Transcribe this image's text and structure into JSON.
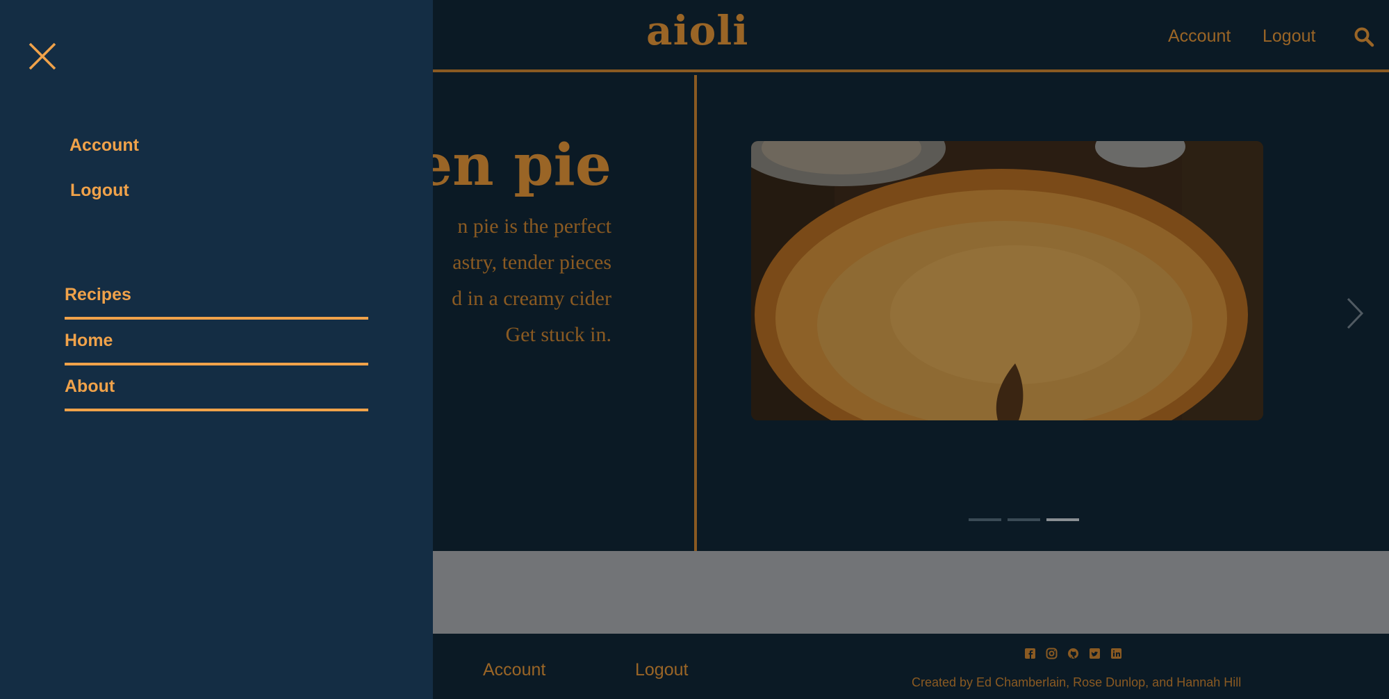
{
  "header": {
    "logo": "aioli",
    "account": "Account",
    "logout": "Logout"
  },
  "hero": {
    "title": "ken pie",
    "description_lines": [
      "n pie is the perfect",
      "astry, tender pieces",
      "d in a creamy cider",
      "Get stuck in."
    ]
  },
  "carousel": {
    "slide_count": 3,
    "active_slide": 3
  },
  "footer": {
    "account": "Account",
    "logout": "Logout",
    "credit": "Created by Ed Chamberlain, Rose Dunlop, and Hannah Hill",
    "socials": [
      "facebook-icon",
      "instagram-icon",
      "github-icon",
      "twitter-icon",
      "linkedin-icon"
    ]
  },
  "drawer": {
    "account": "Account",
    "logout": "Logout",
    "nav": [
      {
        "label": "Recipes"
      },
      {
        "label": "Home"
      },
      {
        "label": "About"
      }
    ]
  },
  "colors": {
    "accent": "#f0a24a",
    "drawer_bg": "#142d44",
    "page_bg": "#0b1a25"
  }
}
